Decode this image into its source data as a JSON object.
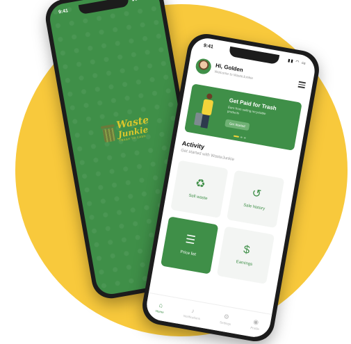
{
  "splash": {
    "status_time": "9:41",
    "logo_word1": "Waste",
    "logo_word2": "Junkie",
    "logo_tag": "TRASH TO CASH"
  },
  "home": {
    "status_time": "9:41",
    "greeting": "Hi, Golden",
    "welcome": "Welcome to WasteJunkie",
    "banner": {
      "title": "Get Paid for Trash",
      "subtitle": "Earn from selling recyclable products",
      "button": "Get Started"
    },
    "activity_title": "Activity",
    "activity_subtitle": "Get started with WasteJunkie",
    "tiles": {
      "sell": "Sell waste",
      "history": "Sale history",
      "price": "Price list",
      "earnings": "Earnings"
    },
    "nav": {
      "home": "Home",
      "notifications": "Notifications",
      "settings": "Settings",
      "profile": "Profile"
    }
  },
  "colors": {
    "brand_green": "#3f8f48",
    "accent_yellow": "#f8c93c"
  }
}
